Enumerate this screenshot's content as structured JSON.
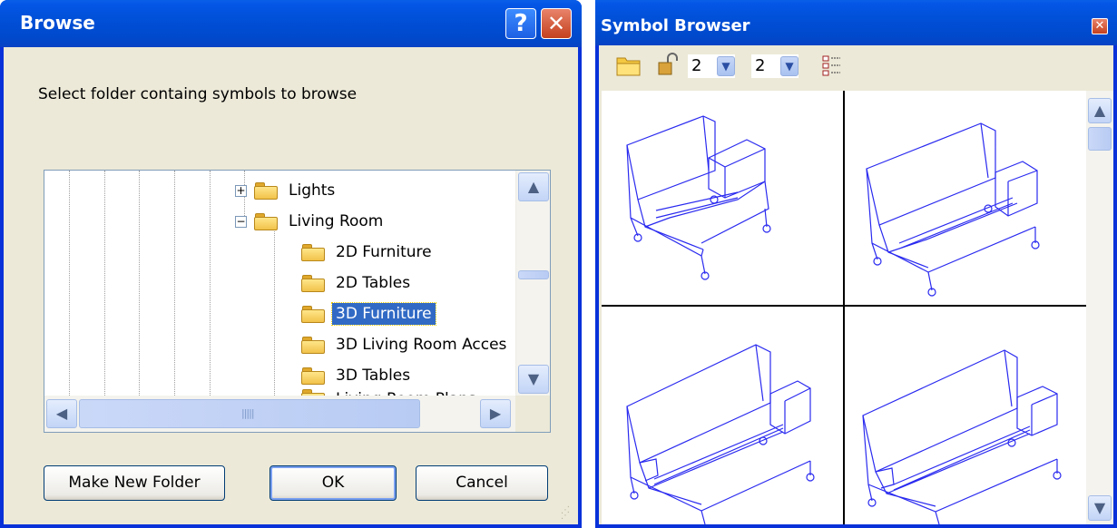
{
  "browse": {
    "title": "Browse",
    "help_glyph": "?",
    "close_glyph": "✕",
    "prompt": "Select folder containg symbols to browse",
    "tree": [
      {
        "label": "Lights",
        "expander": "+",
        "selected": false
      },
      {
        "label": "Living Room",
        "expander": "−",
        "selected": false
      },
      {
        "label": "2D Furniture",
        "expander": "",
        "selected": false
      },
      {
        "label": "2D Tables",
        "expander": "",
        "selected": false
      },
      {
        "label": "3D Furniture",
        "expander": "",
        "selected": true
      },
      {
        "label": "3D Living Room Acces",
        "expander": "",
        "selected": false
      },
      {
        "label": "3D Tables",
        "expander": "",
        "selected": false
      },
      {
        "label": "Living Room Plans",
        "expander": "",
        "selected": false
      }
    ],
    "buttons": {
      "new_folder": "Make New Folder",
      "ok": "OK",
      "cancel": "Cancel"
    },
    "scroll": {
      "up": "▲",
      "down": "▼",
      "left": "◀",
      "right": "▶"
    }
  },
  "symbol_browser": {
    "title": "Symbol Browser",
    "close_glyph": "✕",
    "toolbar": {
      "rows": "2",
      "cols": "2",
      "combo_arrow": "▼"
    },
    "items": [
      "sofa-right-arm-1",
      "sofa-right-arm-2",
      "sofa-long-1",
      "sofa-long-2"
    ],
    "line_color": "#2a2af0",
    "scroll": {
      "up": "▲",
      "down": "▼"
    }
  },
  "colors": {
    "title_blue": "#0054e3",
    "selection": "#316ac5",
    "dialog_face": "#ece9d8"
  }
}
